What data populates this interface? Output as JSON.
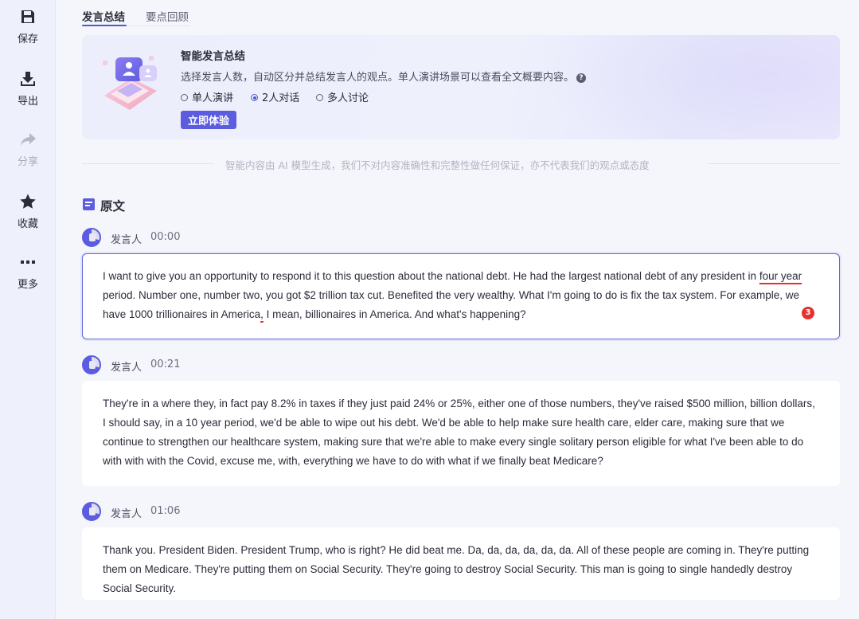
{
  "sidebar": {
    "items": [
      {
        "label": "保存",
        "icon": "save-icon"
      },
      {
        "label": "导出",
        "icon": "download-icon"
      },
      {
        "label": "分享",
        "icon": "share-icon",
        "disabled": true
      },
      {
        "label": "收藏",
        "icon": "star-icon"
      },
      {
        "label": "更多",
        "icon": "more-icon"
      }
    ]
  },
  "tabs": [
    {
      "label": "发言总结",
      "active": true
    },
    {
      "label": "要点回顾",
      "active": false
    }
  ],
  "promo": {
    "title": "智能发言总结",
    "description": "选择发言人数，自动区分并总结发言人的观点。单人演讲场景可以查看全文概要内容。",
    "help_icon": "?",
    "options": [
      {
        "label": "单人演讲",
        "checked": false
      },
      {
        "label": "2人对话",
        "checked": true
      },
      {
        "label": "多人讨论",
        "checked": false
      }
    ],
    "button_label": "立即体验"
  },
  "disclaimer": "智能内容由 AI 模型生成，我们不对内容准确性和完整性做任何保证，亦不代表我们的观点或态度",
  "section_title": "原文",
  "transcript": [
    {
      "speaker": "发言人",
      "time": "00:00",
      "segments": [
        "I want to give you an opportunity to respond it to this question about the national debt. He had the largest national debt of any president in ",
        "four year",
        " period. Number one, number two, you got $2 trillion tax cut. Benefited the very wealthy. What I'm going to do is fix the tax system. For example, we have 1000 trillionaires in America",
        ",",
        " I mean, billionaires in America. And what's happening?"
      ],
      "error_count": "3"
    },
    {
      "speaker": "发言人",
      "time": "00:21",
      "text": "They're in a where they, in fact pay 8.2% in taxes if they just paid 24% or 25%, either one of those numbers, they've raised $500 million, billion dollars, I should say, in a 10 year period, we'd be able to wipe out his debt. We'd be able to help make sure health care, elder care, making sure that we continue to strengthen our healthcare system, making sure that we're able to make every single solitary person eligible for what I've been able to do with with with the Covid, excuse me, with, everything we have to do with what if we finally beat Medicare?"
    },
    {
      "speaker": "发言人",
      "time": "01:06",
      "text": "Thank you. President Biden. President Trump, who is right? He did beat me. Da, da, da, da, da, da. All of these people are coming in. They're putting them on Medicare. They're putting them on Social Security. They're going to destroy Social Security. This man is going to single handedly destroy Social Security."
    }
  ],
  "colors": {
    "accent": "#5b5ce0",
    "error": "#e5302e",
    "sidebar_bg": "#eef0fb"
  }
}
